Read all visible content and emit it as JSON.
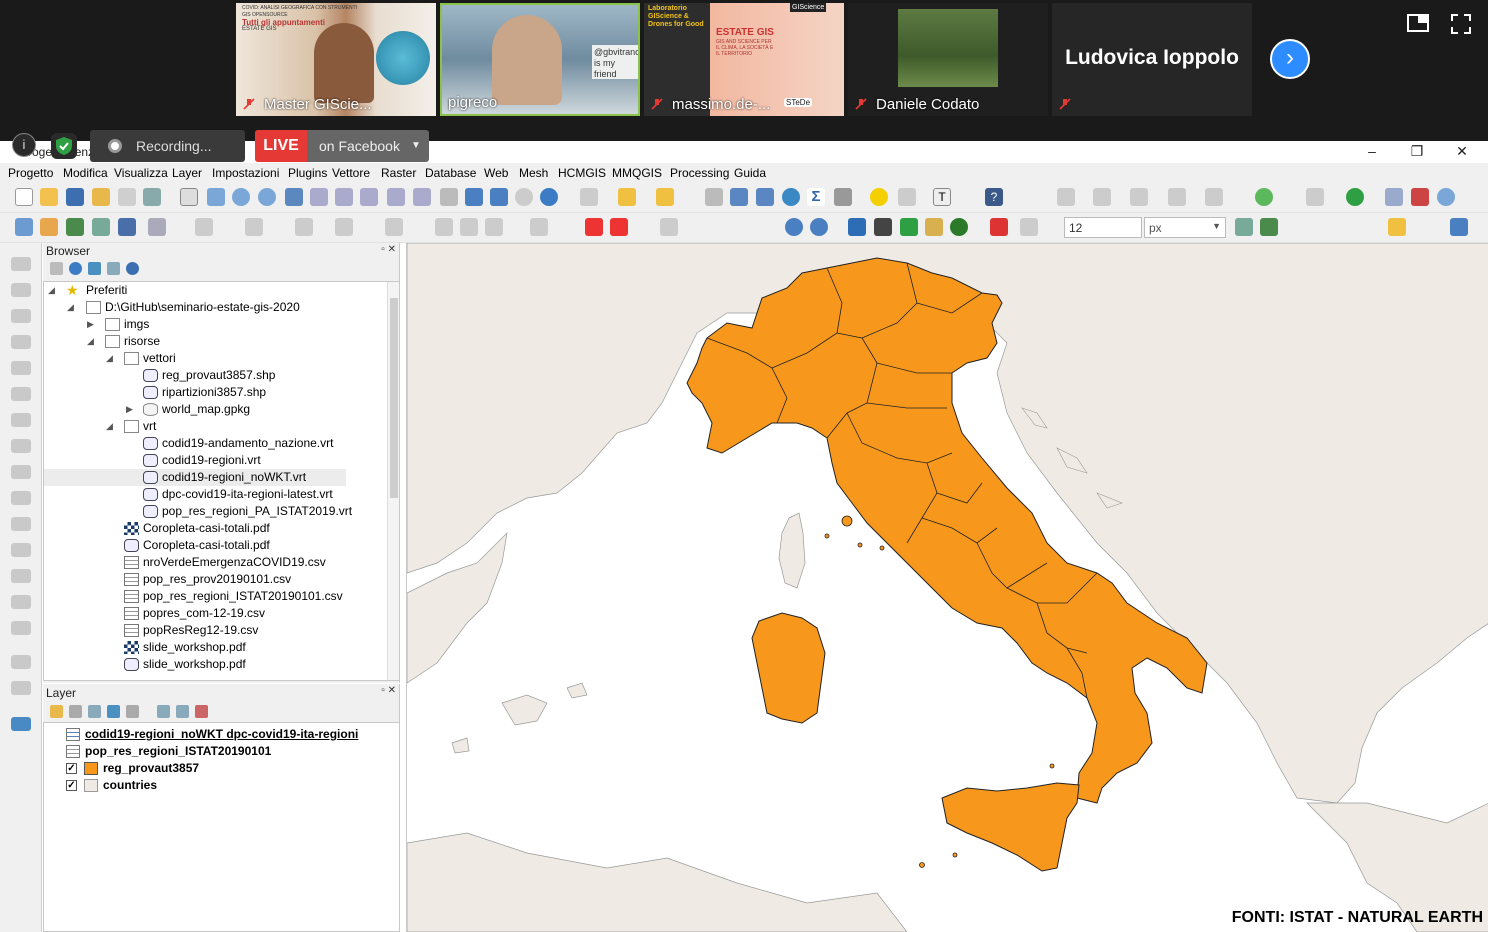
{
  "meeting": {
    "participants": [
      {
        "name": "Master GIScie..."
      },
      {
        "name": "pigreco"
      },
      {
        "name": "massimo.de-..."
      },
      {
        "name": "Daniele Codato"
      },
      {
        "name": "Ludovica Ioppolo"
      }
    ],
    "tile1_lines": [
      "COVID: ANALISI GEOGRAFICA CON STRUMENTI GIS OPENSOURCE",
      "Tutti gli appuntamenti",
      "ESTATE GIS"
    ],
    "tile2_sign": "@gbvitrano is my friend",
    "tile3_lines": [
      "Laboratorio GIScience & Drones for Good",
      "ESTATE GIS",
      "GIS AND SCIENCE PER IL CLIMA, LA SOCIETÀ E IL TERRITORIO",
      "STeDe",
      "GIScience"
    ],
    "recording_label": "Recording...",
    "live_tag": "LIVE",
    "live_text": "on Facebook"
  },
  "qgis": {
    "window_title": "Progetto senza titolo — QGIS",
    "menu": [
      "Progetto",
      "Modifica",
      "Visualizza",
      "Layer",
      "Impostazioni",
      "Plugins",
      "Vettore",
      "Raster",
      "Database",
      "Web",
      "Mesh",
      "HCMGIS",
      "MMQGIS",
      "Processing",
      "Guida"
    ],
    "font_size_value": "12",
    "unit_value": "px",
    "browser": {
      "title": "Browser",
      "items": [
        {
          "label": "Preferiti"
        },
        {
          "label": "D:\\GitHub\\seminario-estate-gis-2020"
        },
        {
          "label": "imgs"
        },
        {
          "label": "risorse"
        },
        {
          "label": "vettori"
        },
        {
          "label": "reg_provaut3857.shp"
        },
        {
          "label": "ripartizioni3857.shp"
        },
        {
          "label": "world_map.gpkg"
        },
        {
          "label": "vrt"
        },
        {
          "label": "codid19-andamento_nazione.vrt"
        },
        {
          "label": "codid19-regioni.vrt"
        },
        {
          "label": "codid19-regioni_noWKT.vrt"
        },
        {
          "label": "dpc-covid19-ita-regioni-latest.vrt"
        },
        {
          "label": "pop_res_regioni_PA_ISTAT2019.vrt"
        },
        {
          "label": "Coropleta-casi-totali.pdf"
        },
        {
          "label": "Coropleta-casi-totali.pdf"
        },
        {
          "label": "nroVerdeEmergenzaCOVID19.csv"
        },
        {
          "label": "pop_res_prov20190101.csv"
        },
        {
          "label": "pop_res_regioni_ISTAT20190101.csv"
        },
        {
          "label": "popres_com-12-19.csv"
        },
        {
          "label": "popResReg12-19.csv"
        },
        {
          "label": "slide_workshop.pdf"
        },
        {
          "label": "slide_workshop.pdf"
        }
      ]
    },
    "layers": {
      "title": "Layer",
      "items": [
        {
          "label": "codid19-regioni_noWKT dpc-covid19-ita-regioni",
          "checked": false
        },
        {
          "label": "pop_res_regioni_ISTAT20190101",
          "checked": false
        },
        {
          "label": "reg_provaut3857",
          "checked": true,
          "color": "#f7981d"
        },
        {
          "label": "countries",
          "checked": true,
          "color": "#efebe4"
        }
      ]
    },
    "map": {
      "credits": "FONTI: ISTAT - NATURAL EARTH",
      "italy_fill": "#f7981d",
      "land_fill": "#efebe4",
      "sea_fill": "#ffffff"
    }
  }
}
